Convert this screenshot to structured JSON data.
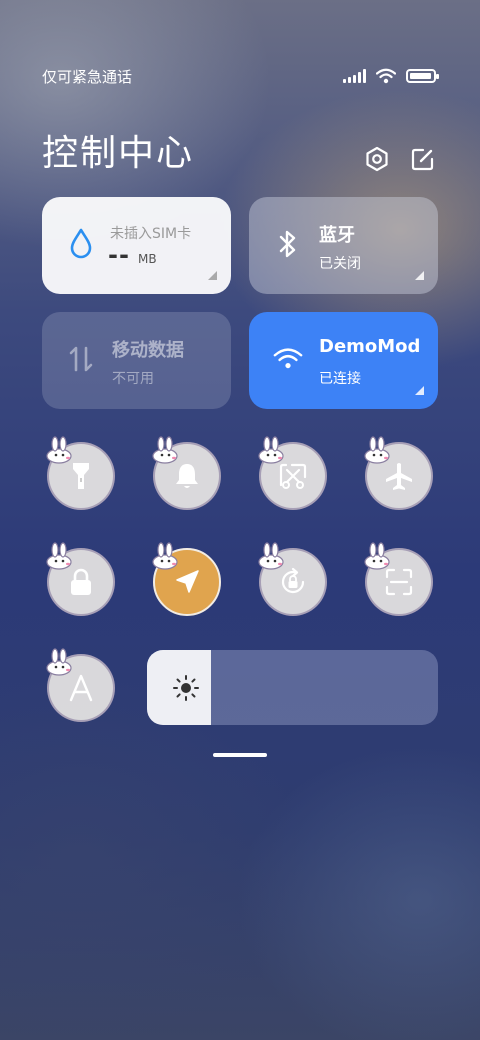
{
  "status_bar": {
    "carrier": "仅可紧急通话",
    "battery_level": 0.95
  },
  "header": {
    "title": "控制中心"
  },
  "tiles": {
    "data_usage": {
      "label": "未插入SIM卡",
      "value": "--",
      "unit": "MB"
    },
    "bluetooth": {
      "title": "蓝牙",
      "status": "已关闭"
    },
    "mobile_data": {
      "title": "移动数据",
      "status": "不可用"
    },
    "wifi": {
      "title": "DemoMod",
      "status": "已连接"
    }
  },
  "toggles": [
    {
      "name": "flashlight",
      "state": "off"
    },
    {
      "name": "bell",
      "state": "off"
    },
    {
      "name": "screenshot",
      "state": "off"
    },
    {
      "name": "airplane",
      "state": "off"
    },
    {
      "name": "lock",
      "state": "off"
    },
    {
      "name": "location",
      "state": "on"
    },
    {
      "name": "rotation-lock",
      "state": "off"
    },
    {
      "name": "scan",
      "state": "off"
    },
    {
      "name": "auto-text",
      "state": "off"
    }
  ],
  "brightness": {
    "level": 0.22
  },
  "colors": {
    "accent_blue": "#3d82f6",
    "active_toggle": "#e0a44e",
    "water_icon": "#2b8ff0"
  }
}
